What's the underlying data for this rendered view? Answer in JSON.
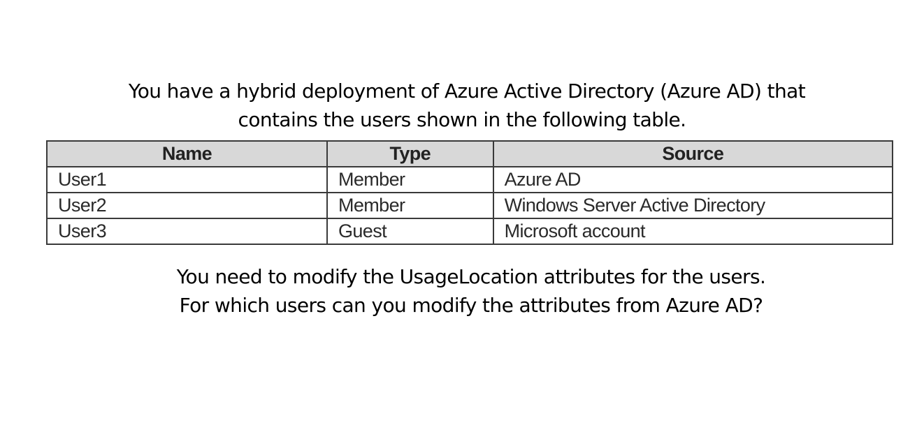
{
  "intro": {
    "line1": "You have a hybrid deployment of Azure Active Directory (Azure AD) that",
    "line2": "contains the users shown in the following table."
  },
  "table": {
    "headers": [
      "Name",
      "Type",
      "Source"
    ],
    "rows": [
      [
        "User1",
        "Member",
        "Azure AD"
      ],
      [
        "User2",
        "Member",
        "Windows Server Active Directory"
      ],
      [
        "User3",
        "Guest",
        "Microsoft account"
      ]
    ]
  },
  "question": {
    "line1": "You need to modify the UsageLocation attributes for the users.",
    "line2": "For which users can you modify the attributes from Azure AD?"
  }
}
